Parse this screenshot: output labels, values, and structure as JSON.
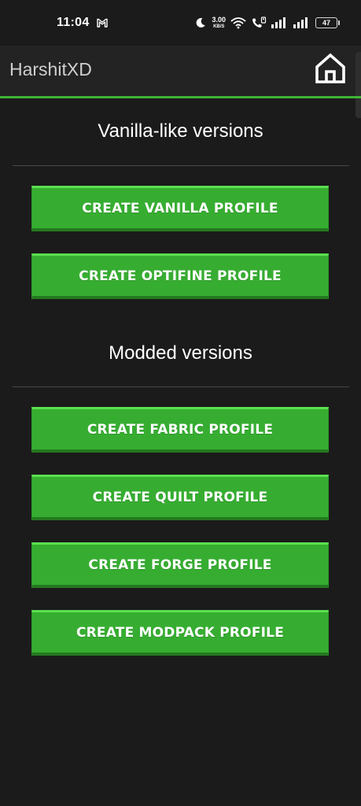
{
  "status_bar": {
    "time": "11:04",
    "mail_icon": "gmail-icon",
    "net_speed_value": "3.00",
    "net_speed_unit": "KB/S",
    "battery_level": "47"
  },
  "app_bar": {
    "title": "HarshitXD",
    "home_icon": "home-icon"
  },
  "sections": {
    "vanilla": {
      "title": "Vanilla-like versions"
    },
    "modded": {
      "title": "Modded versions"
    }
  },
  "buttons": {
    "vanilla": "CREATE VANILLA PROFILE",
    "optifine": "CREATE OPTIFINE PROFILE",
    "fabric": "CREATE FABRIC PROFILE",
    "quilt": "CREATE QUILT PROFILE",
    "forge": "CREATE FORGE PROFILE",
    "modpack": "CREATE MODPACK PROFILE"
  },
  "colors": {
    "background": "#1b1b1b",
    "accent_green": "#36ad31",
    "accent_line": "#3db435"
  }
}
